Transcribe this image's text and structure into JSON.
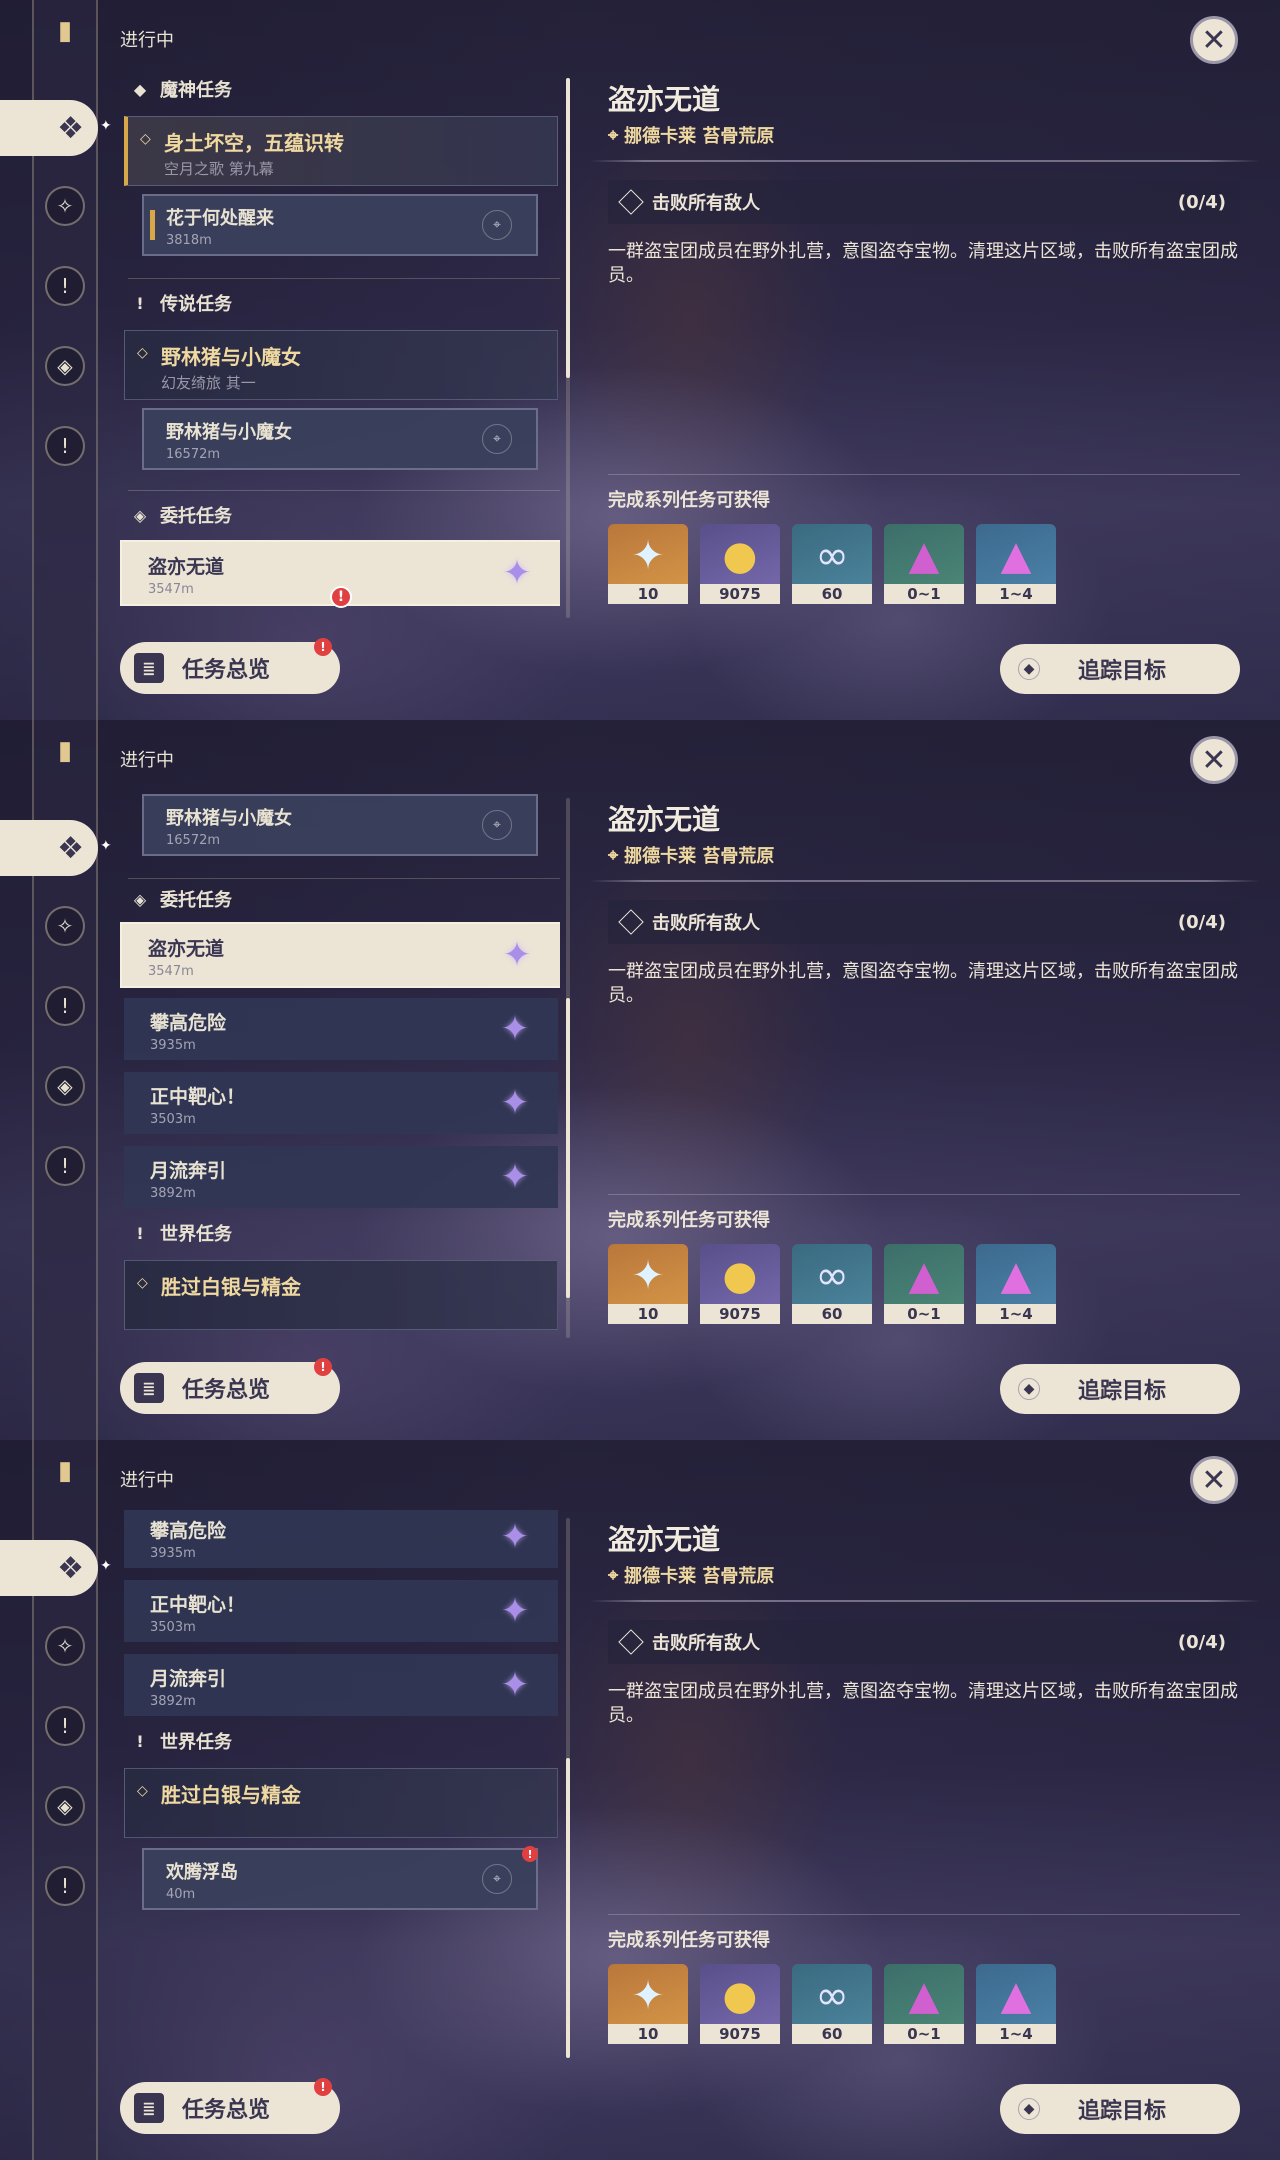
{
  "header": {
    "in_progress": "进行中"
  },
  "quest_detail": {
    "title": "盗亦无道",
    "location": "挪德卡莱 苔骨荒原",
    "objective": "击败所有敌人",
    "progress": "(0/4)",
    "description": "一群盗宝团成员在野外扎营，意图盗夺宝物。清理这片区域，击败所有盗宝团成员。",
    "rewards_title": "完成系列任务可获得",
    "rewards": [
      {
        "icon": "primogem-icon",
        "count": "10"
      },
      {
        "icon": "mora-icon",
        "count": "9075"
      },
      {
        "icon": "companionship-exp-icon",
        "count": "60"
      },
      {
        "icon": "crystal-icon",
        "count": "0~1"
      },
      {
        "icon": "crystal-cluster-icon",
        "count": "1~4"
      }
    ]
  },
  "buttons": {
    "overview": "任务总览",
    "track": "追踪目标"
  },
  "sections": {
    "archon": "魔神任务",
    "legend": "传说任务",
    "commission": "委托任务",
    "world": "世界任务"
  },
  "quests": {
    "archon_main": {
      "title": "身土坏空，五蕴识转",
      "subtitle": "空月之歌 第九幕"
    },
    "archon_sub": {
      "title": "花于何处醒来",
      "distance": "3818m"
    },
    "legend_main": {
      "title": "野林猪与小魔女",
      "subtitle": "幻友绮旅 其一"
    },
    "legend_sub": {
      "title": "野林猪与小魔女",
      "distance": "16572m"
    },
    "commissions": [
      {
        "title": "盗亦无道",
        "distance": "3547m"
      },
      {
        "title": "攀高危险",
        "distance": "3935m"
      },
      {
        "title": "正中靶心！",
        "distance": "3503m"
      },
      {
        "title": "月流奔引",
        "distance": "3892m"
      }
    ],
    "world_main": {
      "title": "胜过白银与精金"
    },
    "world_sub": {
      "title": "欢腾浮岛",
      "distance": "40m"
    }
  }
}
